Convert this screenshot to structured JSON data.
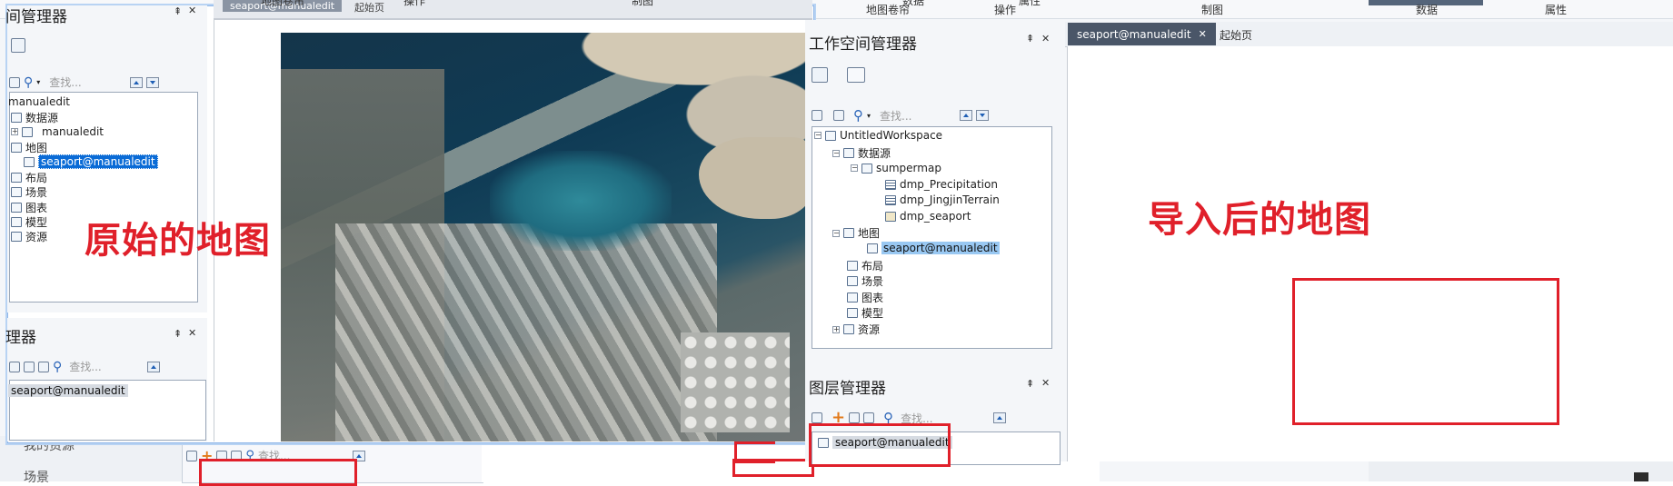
{
  "background": {
    "ribbon": [
      "地图卷帘",
      "操作",
      "属性",
      "数据",
      "制图",
      "数据",
      "属性",
      "地图卷帘",
      "操作",
      "制图"
    ],
    "doc_tabs": [
      "seaport@manualedit",
      "起始页"
    ],
    "sidebar_items": [
      "我的资源",
      "场景"
    ],
    "layer_search_placeholder": "查找..."
  },
  "left_window": {
    "workspace_title": "间管理器",
    "search_placeholder": "查找...",
    "tree": [
      "manualedit",
      "数据源",
      "manualedit",
      "地图",
      "seaport@manualedit",
      "布局",
      "场景",
      "图表",
      "模型",
      "资源"
    ],
    "layer_title": "理器",
    "layer_search_placeholder": "查找...",
    "layer_item": "seaport@manualedit"
  },
  "right_window": {
    "workspace_title": "工作空间管理器",
    "search_placeholder": "查找...",
    "tree": [
      "UntitledWorkspace",
      "数据源",
      "sumpermap",
      "dmp_Precipitation",
      "dmp_JingjinTerrain",
      "dmp_seaport",
      "地图",
      "seaport@manualedit",
      "布局",
      "场景",
      "图表",
      "模型",
      "资源"
    ],
    "layer_title": "图层管理器",
    "layer_search_placeholder": "查找...",
    "layer_item": "seaport@manualedit",
    "tabs": [
      "seaport@manualedit",
      "起始页"
    ]
  },
  "annotations": {
    "original_map": "原始的地图",
    "imported_map": "导入后的地图"
  },
  "colors": {
    "accent_red": "#e0202a",
    "selection_blue": "#0a6bd6",
    "tab_active": "#4a5668",
    "window_frame": "#8fb6e8"
  }
}
